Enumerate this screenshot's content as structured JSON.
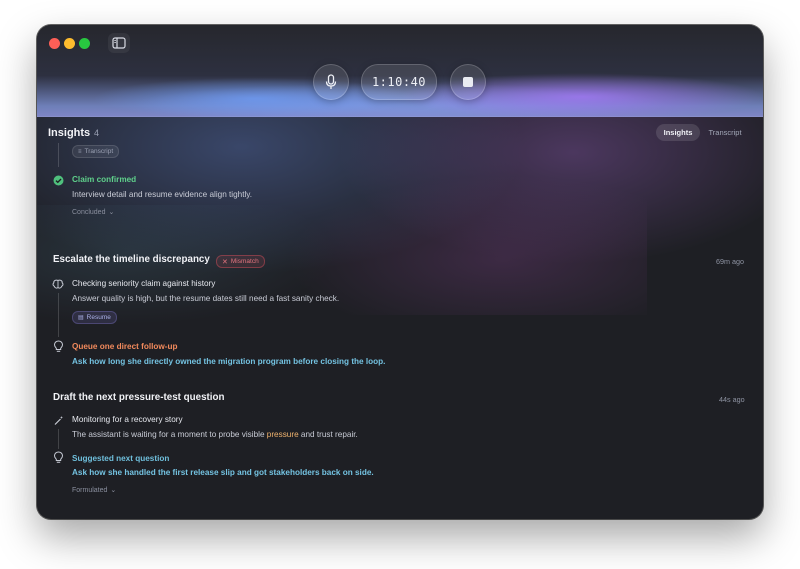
{
  "controls": {
    "timer": "1:10:40"
  },
  "header": {
    "title": "Insights",
    "count": "4",
    "tabs": [
      {
        "label": "Insights",
        "active": true
      },
      {
        "label": "Transcript",
        "active": false
      }
    ]
  },
  "section1": {
    "source_pill": "Transcript",
    "status_title": "Claim confirmed",
    "status_body": "Interview detail and resume evidence align tightly.",
    "footer": "Concluded"
  },
  "card2": {
    "title": "Escalate the timeline discrepancy",
    "badge": "Mismatch",
    "time": "69m ago",
    "step1_title": "Checking seniority claim against history",
    "step1_body": "Answer quality is high, but the resume dates still need a fast sanity check.",
    "source_pill": "Resume",
    "step2_title": "Queue one direct follow-up",
    "step2_body": "Ask how long she directly owned the migration program before closing the loop."
  },
  "card3": {
    "title": "Draft the next pressure-test question",
    "time": "44s ago",
    "step1_title": "Monitoring for a recovery story",
    "step1_body_a": "The assistant is waiting for a moment to probe visible",
    "step1_body_hl": "pressure",
    "step1_body_b": "and trust repair.",
    "step2_title": "Suggested next question",
    "step2_body": "Ask how she handled the first release slip and got stakeholders back on side.",
    "footer": "Formulated"
  },
  "colors": {
    "window_bg": "#1e1f24",
    "success_green": "#5fd08b",
    "warning_orange": "#f28a5c",
    "accent_blue": "#6fbfdc",
    "mismatch_red": "#e3747e",
    "highlight": "#f0b36e"
  },
  "icons": [
    "sidebar-toggle-icon",
    "microphone-icon",
    "stop-icon",
    "check-circle-icon",
    "chevron-down-icon",
    "brain-icon",
    "document-icon",
    "lightbulb-icon",
    "x-icon",
    "wand-icon"
  ]
}
